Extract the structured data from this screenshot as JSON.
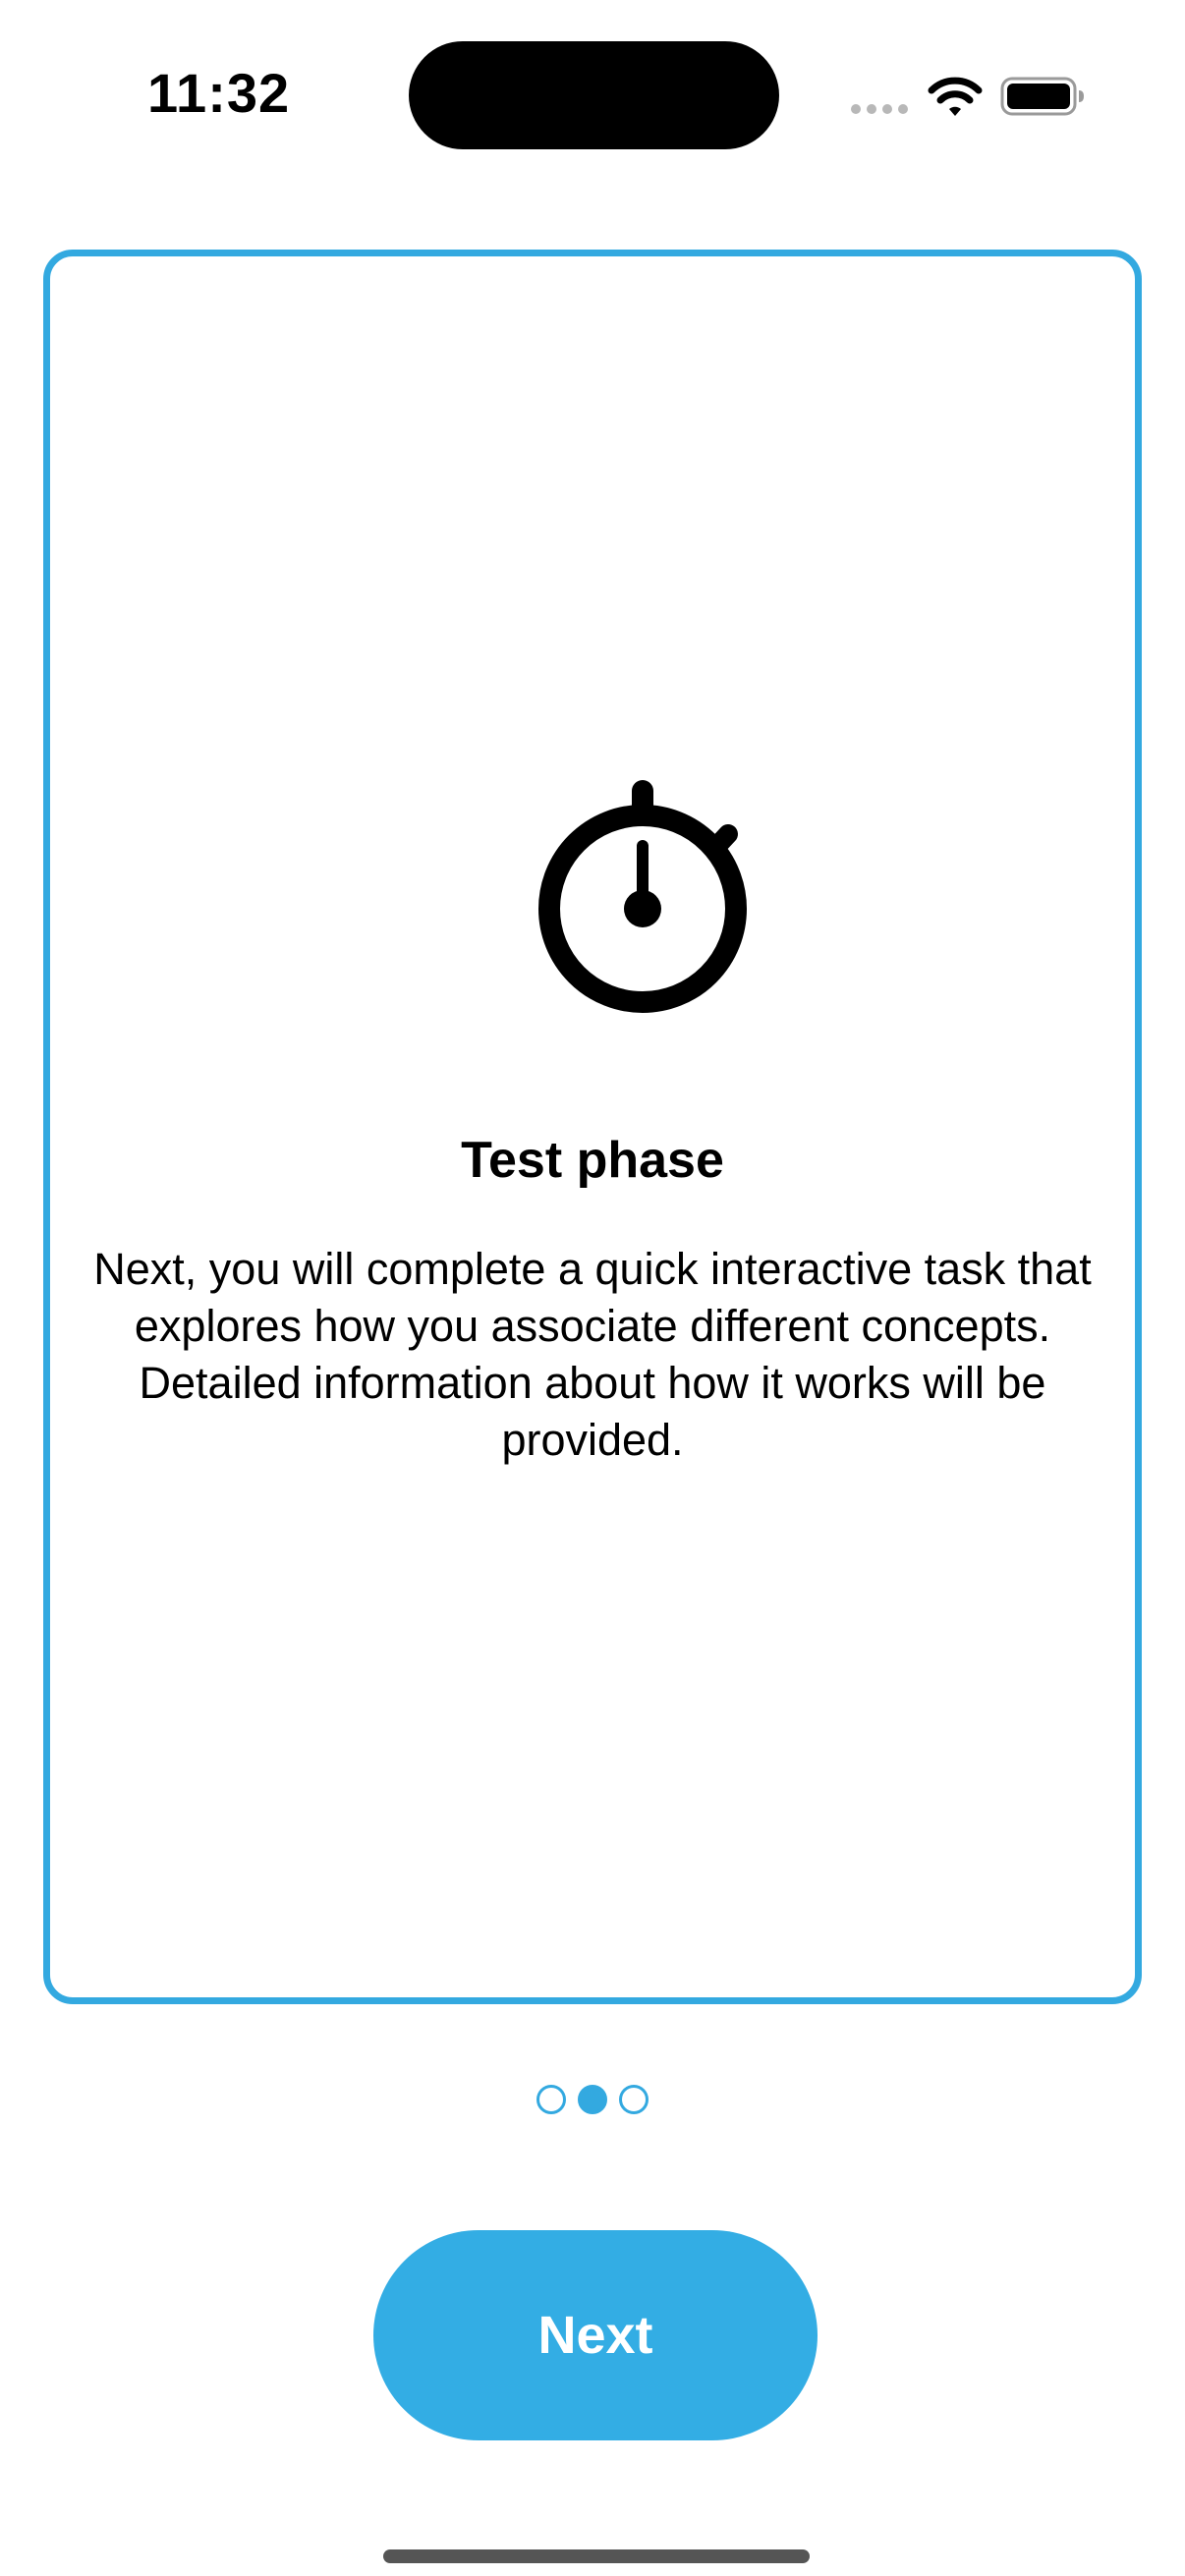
{
  "status_bar": {
    "time": "11:32",
    "wifi_icon": "wifi-icon",
    "battery_icon": "battery-icon"
  },
  "card": {
    "icon": "stopwatch-icon",
    "title": "Test phase",
    "body": "Next, you will complete a quick interactive task that explores how you associate different concepts. Detailed information about how it works will be provided."
  },
  "pager": {
    "total_pages": 3,
    "current_page": 2
  },
  "next_button": {
    "label": "Next"
  },
  "colors": {
    "accent": "#33a9e0",
    "button": "#33ade4",
    "text": "#000000",
    "background": "#ffffff"
  }
}
